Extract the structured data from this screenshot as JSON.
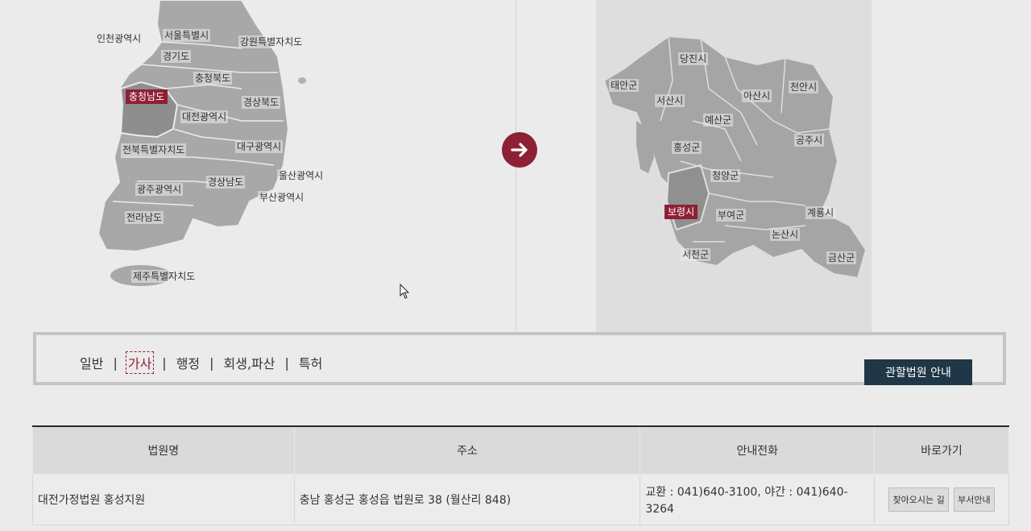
{
  "korea_regions": [
    {
      "id": "incheon",
      "label": "인천광역시"
    },
    {
      "id": "seoul",
      "label": "서울특별시"
    },
    {
      "id": "gangwon",
      "label": "강원특별자치도"
    },
    {
      "id": "gyeonggi",
      "label": "경기도"
    },
    {
      "id": "chungbuk",
      "label": "충청북도"
    },
    {
      "id": "chungnam",
      "label": "충청남도",
      "selected": true
    },
    {
      "id": "gyeongbuk",
      "label": "경상북도"
    },
    {
      "id": "daejeon",
      "label": "대전광역시"
    },
    {
      "id": "jeonbuk",
      "label": "전북특별자치도"
    },
    {
      "id": "daegu",
      "label": "대구광역시"
    },
    {
      "id": "ulsan",
      "label": "울산광역시"
    },
    {
      "id": "gyeongnam",
      "label": "경상남도"
    },
    {
      "id": "gwangju",
      "label": "광주광역시"
    },
    {
      "id": "busan",
      "label": "부산광역시"
    },
    {
      "id": "jeonnam",
      "label": "전라남도"
    },
    {
      "id": "jeju",
      "label": "제주특별자치도"
    }
  ],
  "chungnam_cities": [
    {
      "id": "dangjin",
      "label": "당진시"
    },
    {
      "id": "taean",
      "label": "태안군"
    },
    {
      "id": "seosan",
      "label": "서산시"
    },
    {
      "id": "asan",
      "label": "아산시"
    },
    {
      "id": "cheonan",
      "label": "천안시"
    },
    {
      "id": "yesan",
      "label": "예산군"
    },
    {
      "id": "hongseong",
      "label": "홍성군"
    },
    {
      "id": "gongju",
      "label": "공주시"
    },
    {
      "id": "cheongyang",
      "label": "청양군"
    },
    {
      "id": "boryeong",
      "label": "보령시",
      "selected": true
    },
    {
      "id": "buyeo",
      "label": "부여군"
    },
    {
      "id": "gyeryong",
      "label": "계룡시"
    },
    {
      "id": "nonsan",
      "label": "논산시"
    },
    {
      "id": "seocheon",
      "label": "서천군"
    },
    {
      "id": "geumsan",
      "label": "금산군"
    }
  ],
  "categories": [
    {
      "label": "일반",
      "active": false
    },
    {
      "label": "가사",
      "active": true
    },
    {
      "label": "행정",
      "active": false
    },
    {
      "label": "회생,파산",
      "active": false
    },
    {
      "label": "특허",
      "active": false
    }
  ],
  "category_separator": "|",
  "guide_button": "관할법원 안내",
  "table": {
    "headers": [
      "법원명",
      "주소",
      "안내전화",
      "바로가기"
    ],
    "rows": [
      {
        "name": "대전가정법원 홍성지원",
        "address": "충남 홍성군 홍성읍 법원로 38 (월산리 848)",
        "phone_line1": "교환 : 041)640-3100, 야간 : 041)640-",
        "phone_line2": "3264",
        "buttons": [
          "찾아오시는 길",
          "부서안내"
        ]
      }
    ]
  },
  "colors": {
    "accent": "#8e2035",
    "navy": "#1f3746",
    "map_region": "#a5a5a5",
    "map_selected": "#7a7a7a"
  }
}
